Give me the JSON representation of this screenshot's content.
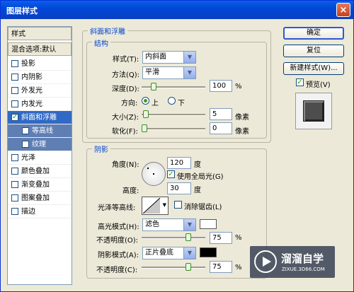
{
  "window": {
    "title": "图层样式",
    "close_glyph": "×"
  },
  "sidebar": {
    "header": "样式",
    "blend_default": "混合选项:默认",
    "items": [
      {
        "label": "投影",
        "checked": false
      },
      {
        "label": "内阴影",
        "checked": false
      },
      {
        "label": "外发光",
        "checked": false
      },
      {
        "label": "内发光",
        "checked": false
      },
      {
        "label": "斜面和浮雕",
        "checked": true
      },
      {
        "label": "等高线",
        "checked": false
      },
      {
        "label": "纹理",
        "checked": false
      },
      {
        "label": "光泽",
        "checked": false
      },
      {
        "label": "颜色叠加",
        "checked": false
      },
      {
        "label": "渐变叠加",
        "checked": false
      },
      {
        "label": "图案叠加",
        "checked": false
      },
      {
        "label": "描边",
        "checked": false
      }
    ],
    "check_glyph": "✓"
  },
  "bevel": {
    "title": "斜面和浮雕",
    "structure": "结构",
    "style_label": "样式(T):",
    "style_value": "内斜面",
    "technique_label": "方法(Q):",
    "technique_value": "平滑",
    "depth_label": "深度(D):",
    "depth_value": "100",
    "depth_unit": "%",
    "direction_label": "方向:",
    "up_label": "上",
    "down_label": "下",
    "size_label": "大小(Z):",
    "size_value": "5",
    "size_unit": "像素",
    "soften_label": "软化(F):",
    "soften_value": "0",
    "soften_unit": "像素"
  },
  "shading": {
    "title": "阴影",
    "angle_label": "角度(N):",
    "angle_value": "120",
    "angle_unit": "度",
    "global_light_label": "使用全局光(G)",
    "altitude_label": "高度:",
    "altitude_value": "30",
    "altitude_unit": "度",
    "gloss_label": "光泽等高线:",
    "antialias_label": "消除锯齿(L)",
    "highlight_mode_label": "高光模式(H):",
    "highlight_mode_value": "滤色",
    "highlight_opacity_label": "不透明度(O):",
    "highlight_opacity_value": "75",
    "highlight_opacity_unit": "%",
    "shadow_mode_label": "阴影模式(A):",
    "shadow_mode_value": "正片叠底",
    "shadow_opacity_label": "不透明度(C):",
    "shadow_opacity_value": "75",
    "shadow_opacity_unit": "%",
    "highlight_color": "#ffffff",
    "shadow_color": "#000000"
  },
  "buttons": {
    "ok": "确定",
    "reset": "复位",
    "new_style": "新建样式(W)...",
    "preview": "预览(V)"
  },
  "slider_levels": {
    "depth": 0.16,
    "size": 0.02,
    "soften": 0.0,
    "highlight_opacity": 0.75,
    "shadow_opacity": 0.75
  },
  "watermark": {
    "main": "溜溜自学",
    "sub": "ZIXUE.3D66.COM"
  }
}
